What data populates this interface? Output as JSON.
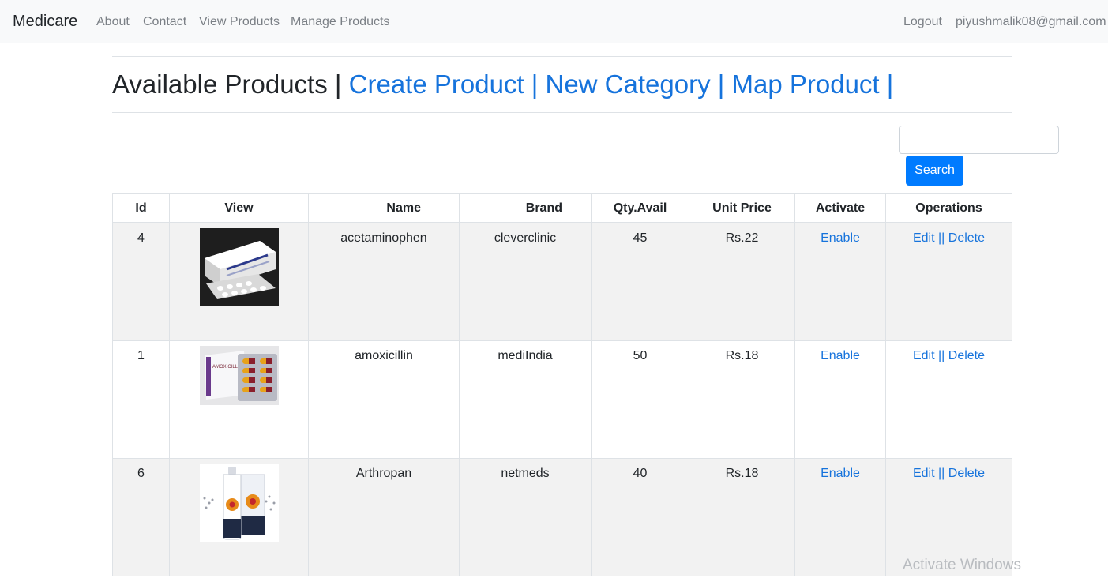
{
  "navbar": {
    "brand": "Medicare",
    "links": [
      "About",
      "Contact",
      "View Products",
      "Manage Products"
    ],
    "logout": "Logout",
    "user_email": "piyushmalik08@gmail.com"
  },
  "heading": {
    "title": "Available Products |",
    "create_product": "Create Product |",
    "new_category": "New Category |",
    "map_product": "Map Product |"
  },
  "search": {
    "value": "",
    "button_label": "Search"
  },
  "table": {
    "headers": [
      "Id",
      "View",
      "Name",
      "Brand",
      "Qty.Avail",
      "Unit Price",
      "Activate",
      "Operations"
    ],
    "rows": [
      {
        "id": "4",
        "name": "acetaminophen",
        "brand": "cleverclinic",
        "qty": "45",
        "price": "Rs.22",
        "activate": "Enable",
        "edit": "Edit",
        "sep": "||",
        "delete": "Delete"
      },
      {
        "id": "1",
        "name": "amoxicillin",
        "brand": "mediIndia",
        "qty": "50",
        "price": "Rs.18",
        "activate": "Enable",
        "edit": "Edit",
        "sep": "||",
        "delete": "Delete"
      },
      {
        "id": "6",
        "name": "Arthropan",
        "brand": "netmeds",
        "qty": "40",
        "price": "Rs.18",
        "activate": "Enable",
        "edit": "Edit",
        "sep": "||",
        "delete": "Delete"
      }
    ]
  },
  "watermark": "Activate Windows",
  "colors": {
    "link": "#1673dc",
    "primary_button": "#007bff",
    "navbar_bg": "#f8f9fa",
    "row_stripe": "#f2f2f2"
  }
}
